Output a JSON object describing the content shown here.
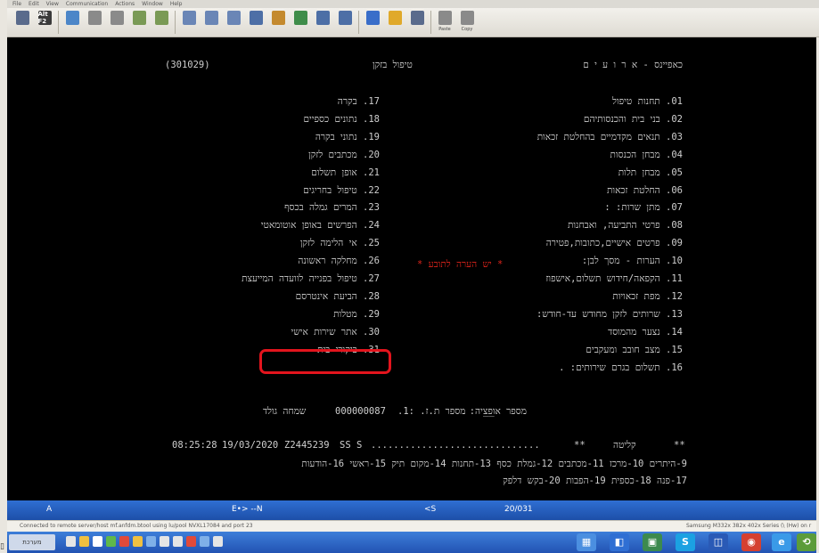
{
  "menu": {
    "items": [
      "File",
      "Edit",
      "View",
      "Communication",
      "Actions",
      "Window",
      "Help"
    ]
  },
  "toolbar": {
    "buttons": [
      {
        "label": "",
        "icon": "screen-icon",
        "color": "#5a6b8c"
      },
      {
        "label": "",
        "icon": "alt-f2-icon",
        "color": "#3a3a3a",
        "text": "Alt F2"
      },
      {
        "label": "",
        "icon": "send-icon",
        "color": "#4c86c8"
      },
      {
        "label": "",
        "icon": "copy-icon",
        "color": "#8a8a8a"
      },
      {
        "label": "",
        "icon": "paste-icon",
        "color": "#8a8a8a"
      },
      {
        "label": "",
        "icon": "key-icon",
        "color": "#7a9a55"
      },
      {
        "label": "",
        "icon": "key-icon",
        "color": "#7a9a55"
      },
      {
        "label": "",
        "icon": "page-icon",
        "color": "#6a86b6"
      },
      {
        "label": "",
        "icon": "window-icon",
        "color": "#6a86b6"
      },
      {
        "label": "",
        "icon": "window-icon",
        "color": "#6a86b6"
      },
      {
        "label": "",
        "icon": "grid-icon",
        "color": "#4d6fa6"
      },
      {
        "label": "",
        "icon": "paint-icon",
        "color": "#c48a2e"
      },
      {
        "label": "",
        "icon": "check-icon",
        "color": "#3f8d4a"
      },
      {
        "label": "",
        "icon": "grid-icon",
        "color": "#4d6fa6"
      },
      {
        "label": "",
        "icon": "grid-icon",
        "color": "#4d6fa6"
      },
      {
        "label": "",
        "icon": "monitor-icon",
        "color": "#3a6ec9"
      },
      {
        "label": "",
        "icon": "folder-icon",
        "color": "#e0a92a"
      },
      {
        "label": "",
        "icon": "chart-icon",
        "color": "#5a6b8c"
      },
      {
        "label": "Paste",
        "icon": "paste-icon",
        "color": "#8a8a8a"
      },
      {
        "label": "Copy",
        "icon": "copy-icon",
        "color": "#8a8a8a"
      }
    ]
  },
  "terminal": {
    "header": {
      "code": "(301029)",
      "title": "טיפול בזקן",
      "system": "כאפיינס - א ר ו ע י ם"
    },
    "left_menu": [
      {
        "num": "01.",
        "text": "תחנות טיפול"
      },
      {
        "num": "02.",
        "text": "בני בית והכנסותיהם"
      },
      {
        "num": "03.",
        "text": "תנאים מקדמיים בהחלטת זכאות"
      },
      {
        "num": "04.",
        "text": "מבחן הכנסות"
      },
      {
        "num": "05.",
        "text": "מבחן תלות"
      },
      {
        "num": "06.",
        "text": "החלטת זכאות"
      },
      {
        "num": "07.",
        "text": "מתן שרות: :"
      },
      {
        "num": "08.",
        "text": "פרטי התביעה, ואבחנות"
      },
      {
        "num": "09.",
        "text": "פרטים אישיים,כתובות,פטירה"
      },
      {
        "num": "10.",
        "text": "הערות - מסך לבן:"
      },
      {
        "num": "11.",
        "text": "הקפאה/חידוש תשלום,אישפוז"
      },
      {
        "num": "12.",
        "text": "מפת זכאויות"
      },
      {
        "num": "13.",
        "text": "שרותים לזקן מחודש עד-חודש:"
      },
      {
        "num": "14.",
        "text": "נצער מהמוסד"
      },
      {
        "num": "15.",
        "text": "מצב חובב ומעקבים"
      },
      {
        "num": "16.",
        "text": "תשלום בגרם שירותים: ."
      }
    ],
    "notes_flag": "* יש הערה לתובע *",
    "right_menu": [
      {
        "num": "17.",
        "text": "בקרה"
      },
      {
        "num": "18.",
        "text": "נתונים כספיים"
      },
      {
        "num": "19.",
        "text": "נתוני בקרה"
      },
      {
        "num": "20.",
        "text": "מכתבים לזקן"
      },
      {
        "num": "21.",
        "text": "אופן תשלום"
      },
      {
        "num": "22.",
        "text": "טיפול בחריגים"
      },
      {
        "num": "23.",
        "text": "המרים גמלה בכסף"
      },
      {
        "num": "24.",
        "text": "הפרשים באופן אוטומאטי"
      },
      {
        "num": "25.",
        "text": "אי הלימה לזקן"
      },
      {
        "num": "26.",
        "text": "מחלקה ראשונה"
      },
      {
        "num": "27.",
        "text": "טיפול בפנייה לוועדה המייעצת"
      },
      {
        "num": "28.",
        "text": "הביעת אינטרסם"
      },
      {
        "num": "29.",
        "text": "מטלות"
      },
      {
        "num": "30.",
        "text": "אתר שירות אישי"
      },
      {
        "num": "31.",
        "text": "ביקורי בית"
      }
    ],
    "selection_line": {
      "option_label": "מספר אופציה:",
      "option_value": "__",
      "id_label": "מספר ת.ז. :1.",
      "id_value": "000000087",
      "name": "שמחה גולד"
    },
    "status_line": {
      "time": "08:25:28",
      "date": "19/03/2020",
      "code": "Z2445239",
      "mode": "SS S",
      "dots": "..............................",
      "stars": "**",
      "label": "קליטה",
      "stars2": "**"
    },
    "fkeys_1": "9-היתרים 10-מרכז 11-מכתבים 12-גמלת כסף 13-תחנות 14-מקום תיק 15-ראשי 16-הודעות",
    "fkeys_2": "17-פנה 18-כספית 19-הפבות 20-בקש דלפק"
  },
  "statusbar": {
    "left": "A",
    "mid": "E•> --N",
    "cs": "<S",
    "position": "20/031"
  },
  "connection": {
    "text": "Connected to remote server/host mf.anfdm.btool using lu/pool NVXL17084 and port 23",
    "right": "Samsung M332x 382x 402x Series (\\ (Hw) on r"
  },
  "taskbar": {
    "start": "מערכת"
  }
}
